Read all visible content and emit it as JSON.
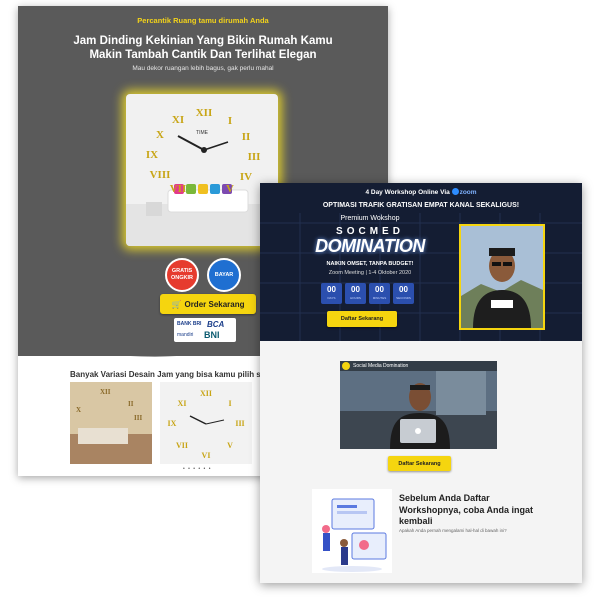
{
  "clock_page": {
    "tagline": "Percantik Ruang tamu dirumah Anda",
    "title": "Jam Dinding Kekinian Yang Bikin Rumah Kamu Makin Tambah Cantik Dan Terlihat Elegan",
    "subtitle": "Mau dekor ruangan lebih bagus, gak perlu mahal",
    "clock_brand": "TIME",
    "badge_free_ongkir": "GRATIS ONGKIR",
    "badge_bayar": "BAYAR",
    "order_button": "Order Sekarang",
    "banks": [
      "BANK BRI",
      "BCA",
      "mandiri",
      "BNI"
    ],
    "variety_heading": "Banyak Variasi Desain Jam yang bisa kamu pilih s",
    "carousel_dots": "• • • • • •"
  },
  "workshop_page": {
    "days_prefix": "4 Day Workshop Online Via",
    "zoom_label": "zoom",
    "optimasi": "OPTIMASI TRAFIK GRATISAN EMPAT KANAL SEKALIGUS!",
    "premium": "Premium Wokshop",
    "socmed": "SOCMED",
    "domination": "DOMINATION",
    "naikin": "NAIKIN OMSET, TANPA BUDGET!",
    "zoom_meeting": "Zoom Meeting | 1-4 Oktober 2020",
    "timer": [
      {
        "value": "00",
        "label": "DAYS"
      },
      {
        "value": "00",
        "label": "HOURS"
      },
      {
        "value": "00",
        "label": "MINUTES"
      },
      {
        "value": "00",
        "label": "SECONDS"
      }
    ],
    "daftar_button_1": "Daftar Sekarang",
    "video_title": "Social Media Domination",
    "daftar_button_2": "Daftar Sekarang",
    "before_heading": "Sebelum Anda Daftar Workshopnya, coba Anda ingat kembali",
    "ask_text": "Apakah Anda pernah mengalami hal-hal di bawah ini?"
  },
  "colors": {
    "accent_yellow": "#f5d50f",
    "hero_gray": "#5a5a5a",
    "hero_navy": "#141d33",
    "zoom_blue": "#2d8cff"
  }
}
